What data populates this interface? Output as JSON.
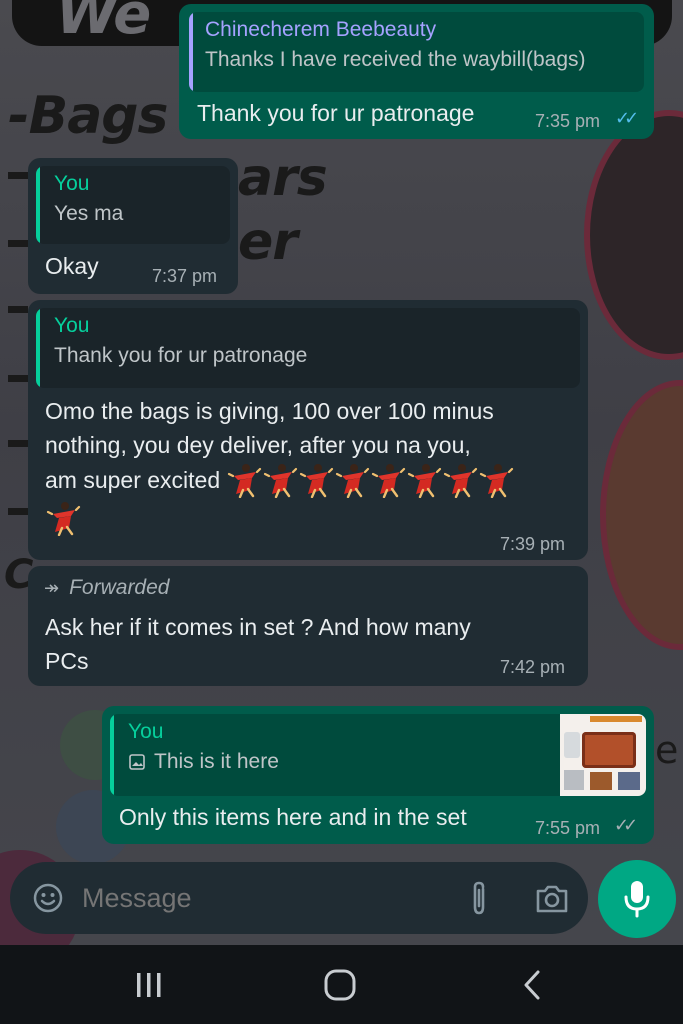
{
  "messages": [
    {
      "id": "m1",
      "direction": "outgoing",
      "quote_author": "Chinecherem Beebeauty",
      "quote_text": "Thanks I have received the waybill(bags)",
      "text": "Thank you for ur patronage",
      "time": "7:35 pm",
      "status": "read"
    },
    {
      "id": "m2",
      "direction": "incoming",
      "quote_author": "You",
      "quote_text": "Yes ma",
      "text": "Okay",
      "time": "7:37 pm"
    },
    {
      "id": "m3",
      "direction": "incoming",
      "quote_author": "You",
      "quote_text": "Thank you for ur patronage",
      "text_lines": [
        "Omo the bags is giving, 100 over 100 minus",
        "nothing, you dey deliver, after you na you,",
        "am super excited"
      ],
      "emoji_count": 9,
      "emoji_name": "dancer-emoji",
      "time": "7:39 pm"
    },
    {
      "id": "m4",
      "direction": "incoming",
      "forwarded_label": "Forwarded",
      "text_lines": [
        "Ask her if it comes in set ? And how many",
        "PCs"
      ],
      "time": "7:42 pm"
    },
    {
      "id": "m5",
      "direction": "outgoing",
      "quote_author": "You",
      "quote_text": "This is it here",
      "quote_icon": "image-icon",
      "quote_thumbnail": "cookware-photo",
      "text": "Only this items here and in the set",
      "time": "7:55 pm",
      "status": "delivered"
    }
  ],
  "wallpaper": {
    "text_bags": "-Bags",
    "text_ars": "ars",
    "text_er": "er",
    "text_we": "We"
  },
  "input": {
    "placeholder": "Message",
    "emoji_icon": "smiley-icon",
    "attach_icon": "paperclip-icon",
    "camera_icon": "camera-icon",
    "mic_icon": "microphone-icon"
  },
  "colors": {
    "outgoing_bubble": "#005c4b",
    "incoming_bubble": "#202c33",
    "accent": "#00a884",
    "read_ticks": "#53bdeb",
    "quote_you": "#06cf9c",
    "quote_contact": "#a5a2ff"
  },
  "navbar": {
    "recents_icon": "recents-icon",
    "home_icon": "home-icon",
    "back_icon": "back-icon"
  }
}
